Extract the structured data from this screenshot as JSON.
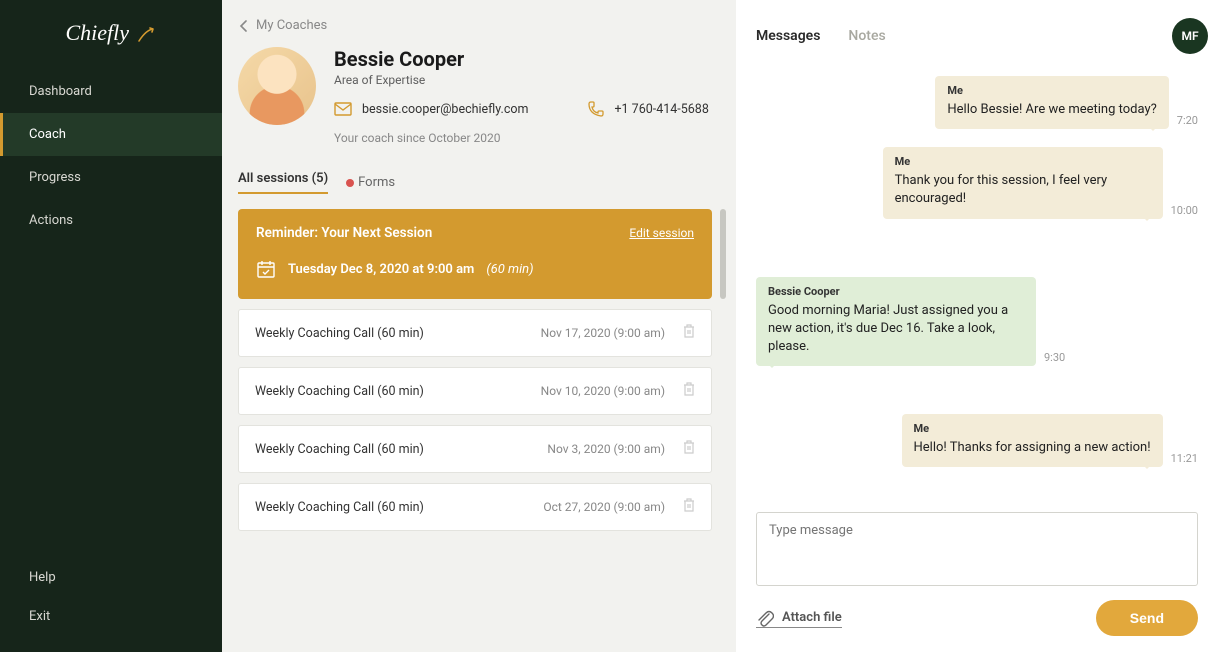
{
  "brand": "Chiefly",
  "nav": {
    "items": [
      {
        "label": "Dashboard",
        "active": false
      },
      {
        "label": "Coach",
        "active": true
      },
      {
        "label": "Progress",
        "active": false
      },
      {
        "label": "Actions",
        "active": false
      }
    ],
    "bottom": [
      {
        "label": "Help"
      },
      {
        "label": "Exit"
      }
    ]
  },
  "breadcrumb": "My Coaches",
  "coach": {
    "name": "Bessie Cooper",
    "subtitle": "Area of Expertise",
    "email": "bessie.cooper@bechiefly.com",
    "phone": "+1 760-414-5688",
    "since": "Your coach since October 2020"
  },
  "session_tabs": {
    "all": "All sessions (5)",
    "forms": "Forms"
  },
  "reminder": {
    "title": "Reminder: Your Next Session",
    "edit": "Edit session",
    "date": "Tuesday Dec 8, 2020 at 9:00 am",
    "duration": "(60 min)"
  },
  "sessions": [
    {
      "title": "Weekly Coaching Call (60 min)",
      "date": "Nov 17, 2020 (9:00 am)"
    },
    {
      "title": "Weekly Coaching Call (60 min)",
      "date": "Nov 10, 2020 (9:00 am)"
    },
    {
      "title": "Weekly Coaching Call (60 min)",
      "date": "Nov 3, 2020 (9:00 am)"
    },
    {
      "title": "Weekly Coaching Call (60 min)",
      "date": "Oct 27, 2020 (9:00 am)"
    }
  ],
  "right_tabs": {
    "messages": "Messages",
    "notes": "Notes"
  },
  "user_initials": "MF",
  "messages": [
    {
      "who": "me",
      "sender": "Me",
      "text": "Hello Bessie! Are we meeting today?",
      "time": "7:20"
    },
    {
      "who": "me",
      "sender": "Me",
      "text": "Thank you for this session, I feel very encouraged!",
      "time": "10:00"
    },
    {
      "who": "them",
      "sender": "Bessie Cooper",
      "text": "Good morning Maria! Just assigned you a new action, it's due Dec 16. Take a look, please.",
      "time": "9:30"
    },
    {
      "who": "me",
      "sender": "Me",
      "text": "Hello! Thanks for assigning a new action!",
      "time": "11:21"
    }
  ],
  "compose": {
    "placeholder": "Type message",
    "attach": "Attach file",
    "send": "Send"
  }
}
